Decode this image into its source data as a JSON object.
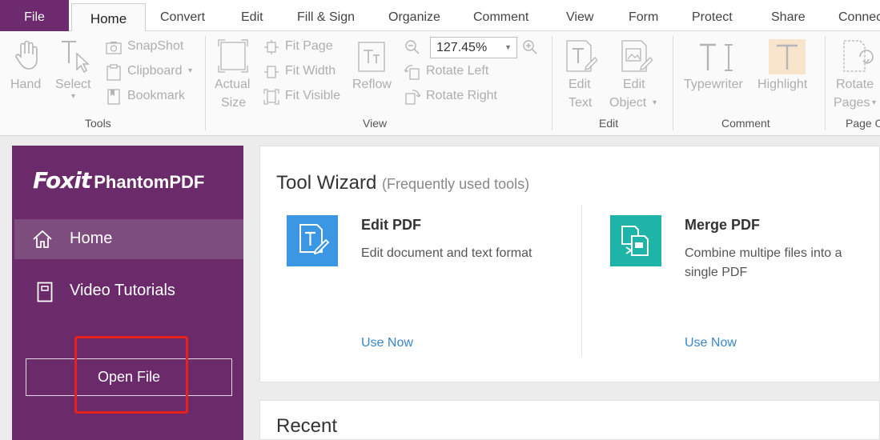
{
  "menu": {
    "tabs": [
      {
        "label": "File"
      },
      {
        "label": "Home"
      },
      {
        "label": "Convert"
      },
      {
        "label": "Edit"
      },
      {
        "label": "Fill & Sign"
      },
      {
        "label": "Organize"
      },
      {
        "label": "Comment"
      },
      {
        "label": "View"
      },
      {
        "label": "Form"
      },
      {
        "label": "Protect"
      },
      {
        "label": "Share"
      },
      {
        "label": "Connec"
      }
    ]
  },
  "ribbon": {
    "tools": {
      "hand": "Hand",
      "select": "Select",
      "snapshot": "SnapShot",
      "clipboard": "Clipboard",
      "bookmark": "Bookmark",
      "group": "Tools"
    },
    "view": {
      "actual_size_1": "Actual",
      "actual_size_2": "Size",
      "fit_page": "Fit Page",
      "fit_width": "Fit Width",
      "fit_visible": "Fit Visible",
      "reflow": "Reflow",
      "zoom": "127.45%",
      "rotate_left": "Rotate Left",
      "rotate_right": "Rotate Right",
      "group": "View"
    },
    "edit": {
      "edit_text_1": "Edit",
      "edit_text_2": "Text",
      "edit_object_1": "Edit",
      "edit_object_2": "Object",
      "group": "Edit"
    },
    "comment": {
      "typewriter": "Typewriter",
      "highlight": "Highlight",
      "group": "Comment"
    },
    "page": {
      "rotate_pages_1": "Rotate",
      "rotate_pages_2": "Pages",
      "group": "Page O"
    }
  },
  "sidebar": {
    "brand": "Foxit",
    "product": "PhantomPDF",
    "nav": [
      {
        "label": "Home"
      },
      {
        "label": "Video Tutorials"
      }
    ],
    "open_file": "Open File"
  },
  "wizard": {
    "title": "Tool Wizard",
    "subtitle": "(Frequently used tools)",
    "tools": [
      {
        "name": "Edit PDF",
        "desc": "Edit document and text format",
        "action": "Use Now",
        "color": "#3b97e3"
      },
      {
        "name": "Merge PDF",
        "desc": "Combine multipe files into a single PDF",
        "action": "Use Now",
        "color": "#1fb4a8"
      }
    ]
  },
  "recent": {
    "title": "Recent"
  },
  "colors": {
    "brand_purple": "#6b2a6a",
    "link_blue": "#3a87c8",
    "highlight_red": "#e5231b"
  }
}
